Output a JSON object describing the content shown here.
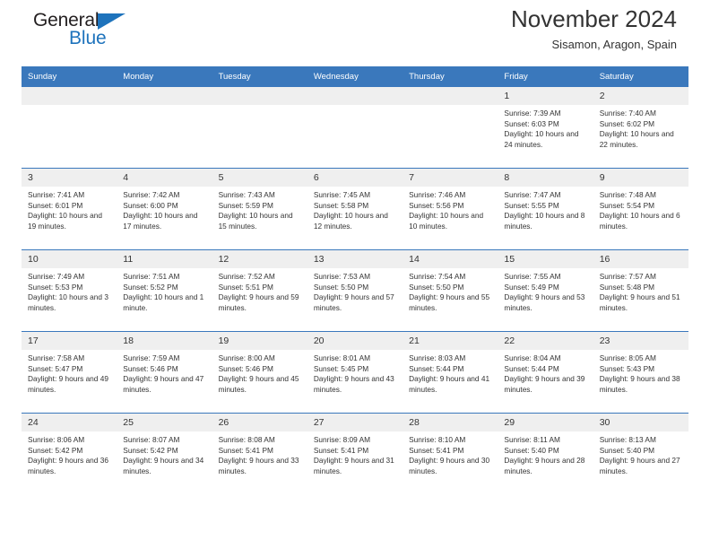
{
  "brand": {
    "name_part1": "General",
    "name_part2": "Blue",
    "triangle_color": "#1e73bc",
    "text_color": "#231f20"
  },
  "header": {
    "title": "November 2024",
    "subtitle": "Sisamon, Aragon, Spain"
  },
  "theme": {
    "header_blue": "#3a78bc",
    "daynum_gray": "#efefef",
    "text_dark": "#333333"
  },
  "weekdays": [
    "Sunday",
    "Monday",
    "Tuesday",
    "Wednesday",
    "Thursday",
    "Friday",
    "Saturday"
  ],
  "labels": {
    "sunrise": "Sunrise:",
    "sunset": "Sunset:",
    "daylight": "Daylight:"
  },
  "weeks": [
    [
      {
        "day": "",
        "empty": true
      },
      {
        "day": "",
        "empty": true
      },
      {
        "day": "",
        "empty": true
      },
      {
        "day": "",
        "empty": true
      },
      {
        "day": "",
        "empty": true
      },
      {
        "day": "1",
        "sunrise": "Sunrise: 7:39 AM",
        "sunset": "Sunset: 6:03 PM",
        "daylight": "Daylight: 10 hours and 24 minutes."
      },
      {
        "day": "2",
        "sunrise": "Sunrise: 7:40 AM",
        "sunset": "Sunset: 6:02 PM",
        "daylight": "Daylight: 10 hours and 22 minutes."
      }
    ],
    [
      {
        "day": "3",
        "sunrise": "Sunrise: 7:41 AM",
        "sunset": "Sunset: 6:01 PM",
        "daylight": "Daylight: 10 hours and 19 minutes."
      },
      {
        "day": "4",
        "sunrise": "Sunrise: 7:42 AM",
        "sunset": "Sunset: 6:00 PM",
        "daylight": "Daylight: 10 hours and 17 minutes."
      },
      {
        "day": "5",
        "sunrise": "Sunrise: 7:43 AM",
        "sunset": "Sunset: 5:59 PM",
        "daylight": "Daylight: 10 hours and 15 minutes."
      },
      {
        "day": "6",
        "sunrise": "Sunrise: 7:45 AM",
        "sunset": "Sunset: 5:58 PM",
        "daylight": "Daylight: 10 hours and 12 minutes."
      },
      {
        "day": "7",
        "sunrise": "Sunrise: 7:46 AM",
        "sunset": "Sunset: 5:56 PM",
        "daylight": "Daylight: 10 hours and 10 minutes."
      },
      {
        "day": "8",
        "sunrise": "Sunrise: 7:47 AM",
        "sunset": "Sunset: 5:55 PM",
        "daylight": "Daylight: 10 hours and 8 minutes."
      },
      {
        "day": "9",
        "sunrise": "Sunrise: 7:48 AM",
        "sunset": "Sunset: 5:54 PM",
        "daylight": "Daylight: 10 hours and 6 minutes."
      }
    ],
    [
      {
        "day": "10",
        "sunrise": "Sunrise: 7:49 AM",
        "sunset": "Sunset: 5:53 PM",
        "daylight": "Daylight: 10 hours and 3 minutes."
      },
      {
        "day": "11",
        "sunrise": "Sunrise: 7:51 AM",
        "sunset": "Sunset: 5:52 PM",
        "daylight": "Daylight: 10 hours and 1 minute."
      },
      {
        "day": "12",
        "sunrise": "Sunrise: 7:52 AM",
        "sunset": "Sunset: 5:51 PM",
        "daylight": "Daylight: 9 hours and 59 minutes."
      },
      {
        "day": "13",
        "sunrise": "Sunrise: 7:53 AM",
        "sunset": "Sunset: 5:50 PM",
        "daylight": "Daylight: 9 hours and 57 minutes."
      },
      {
        "day": "14",
        "sunrise": "Sunrise: 7:54 AM",
        "sunset": "Sunset: 5:50 PM",
        "daylight": "Daylight: 9 hours and 55 minutes."
      },
      {
        "day": "15",
        "sunrise": "Sunrise: 7:55 AM",
        "sunset": "Sunset: 5:49 PM",
        "daylight": "Daylight: 9 hours and 53 minutes."
      },
      {
        "day": "16",
        "sunrise": "Sunrise: 7:57 AM",
        "sunset": "Sunset: 5:48 PM",
        "daylight": "Daylight: 9 hours and 51 minutes."
      }
    ],
    [
      {
        "day": "17",
        "sunrise": "Sunrise: 7:58 AM",
        "sunset": "Sunset: 5:47 PM",
        "daylight": "Daylight: 9 hours and 49 minutes."
      },
      {
        "day": "18",
        "sunrise": "Sunrise: 7:59 AM",
        "sunset": "Sunset: 5:46 PM",
        "daylight": "Daylight: 9 hours and 47 minutes."
      },
      {
        "day": "19",
        "sunrise": "Sunrise: 8:00 AM",
        "sunset": "Sunset: 5:46 PM",
        "daylight": "Daylight: 9 hours and 45 minutes."
      },
      {
        "day": "20",
        "sunrise": "Sunrise: 8:01 AM",
        "sunset": "Sunset: 5:45 PM",
        "daylight": "Daylight: 9 hours and 43 minutes."
      },
      {
        "day": "21",
        "sunrise": "Sunrise: 8:03 AM",
        "sunset": "Sunset: 5:44 PM",
        "daylight": "Daylight: 9 hours and 41 minutes."
      },
      {
        "day": "22",
        "sunrise": "Sunrise: 8:04 AM",
        "sunset": "Sunset: 5:44 PM",
        "daylight": "Daylight: 9 hours and 39 minutes."
      },
      {
        "day": "23",
        "sunrise": "Sunrise: 8:05 AM",
        "sunset": "Sunset: 5:43 PM",
        "daylight": "Daylight: 9 hours and 38 minutes."
      }
    ],
    [
      {
        "day": "24",
        "sunrise": "Sunrise: 8:06 AM",
        "sunset": "Sunset: 5:42 PM",
        "daylight": "Daylight: 9 hours and 36 minutes."
      },
      {
        "day": "25",
        "sunrise": "Sunrise: 8:07 AM",
        "sunset": "Sunset: 5:42 PM",
        "daylight": "Daylight: 9 hours and 34 minutes."
      },
      {
        "day": "26",
        "sunrise": "Sunrise: 8:08 AM",
        "sunset": "Sunset: 5:41 PM",
        "daylight": "Daylight: 9 hours and 33 minutes."
      },
      {
        "day": "27",
        "sunrise": "Sunrise: 8:09 AM",
        "sunset": "Sunset: 5:41 PM",
        "daylight": "Daylight: 9 hours and 31 minutes."
      },
      {
        "day": "28",
        "sunrise": "Sunrise: 8:10 AM",
        "sunset": "Sunset: 5:41 PM",
        "daylight": "Daylight: 9 hours and 30 minutes."
      },
      {
        "day": "29",
        "sunrise": "Sunrise: 8:11 AM",
        "sunset": "Sunset: 5:40 PM",
        "daylight": "Daylight: 9 hours and 28 minutes."
      },
      {
        "day": "30",
        "sunrise": "Sunrise: 8:13 AM",
        "sunset": "Sunset: 5:40 PM",
        "daylight": "Daylight: 9 hours and 27 minutes."
      }
    ]
  ]
}
